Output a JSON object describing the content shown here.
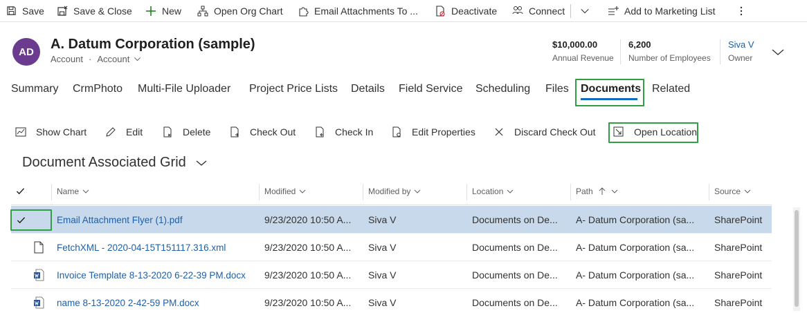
{
  "commandbar": {
    "save": "Save",
    "save_close": "Save & Close",
    "new": "New",
    "open_org_chart": "Open Org Chart",
    "email_attachments": "Email Attachments To ...",
    "deactivate": "Deactivate",
    "connect": "Connect",
    "add_to_marketing_list": "Add to Marketing List"
  },
  "record": {
    "avatar_initials": "AD",
    "title": "A. Datum Corporation (sample)",
    "entity": "Account",
    "form": "Account",
    "annual_revenue_value": "$10,000.00",
    "annual_revenue_label": "Annual Revenue",
    "employees_value": "6,200",
    "employees_label": "Number of Employees",
    "owner_value": "Siva V",
    "owner_label": "Owner"
  },
  "tabs": [
    {
      "label": "Summary"
    },
    {
      "label": "CrmPhoto"
    },
    {
      "label": "Multi-File Uploader"
    },
    {
      "label": "Project Price Lists"
    },
    {
      "label": "Details"
    },
    {
      "label": "Field Service"
    },
    {
      "label": "Scheduling"
    },
    {
      "label": "Files"
    },
    {
      "label": "Documents",
      "active": true
    },
    {
      "label": "Related"
    }
  ],
  "subgrid_commands": {
    "show_chart": "Show Chart",
    "edit": "Edit",
    "delete": "Delete",
    "check_out": "Check Out",
    "check_in": "Check In",
    "edit_properties": "Edit Properties",
    "discard_check_out": "Discard Check Out",
    "open_location": "Open Location"
  },
  "grid": {
    "title": "Document Associated Grid",
    "columns": {
      "name": "Name",
      "modified": "Modified",
      "modified_by": "Modified by",
      "location": "Location",
      "path": "Path",
      "source": "Source"
    },
    "rows": [
      {
        "icon": "pdf-file-icon",
        "name": "Email Attachment Flyer (1).pdf",
        "modified": "9/23/2020 10:50 A...",
        "modified_by": "Siva V",
        "location": "Documents on De...",
        "path": "A- Datum Corporation (sa...",
        "source": "SharePoint",
        "selected": true
      },
      {
        "icon": "blank-file-icon",
        "name": "FetchXML - 2020-04-15T151117.316.xml",
        "modified": "9/23/2020 10:50 A...",
        "modified_by": "Siva V",
        "location": "Documents on De...",
        "path": "A- Datum Corporation (sa...",
        "source": "SharePoint"
      },
      {
        "icon": "word-file-icon",
        "name": "Invoice Template 8-13-2020 6-22-39 PM.docx",
        "modified": "9/23/2020 10:50 A...",
        "modified_by": "Siva V",
        "location": "Documents on De...",
        "path": "A- Datum Corporation (sa...",
        "source": "SharePoint"
      },
      {
        "icon": "word-file-icon",
        "name": "name 8-13-2020 2-42-59 PM.docx",
        "modified": "9/23/2020 10:50 A...",
        "modified_by": "Siva V",
        "location": "Documents on De...",
        "path": "A- Datum Corporation (sa...",
        "source": "SharePoint"
      }
    ]
  },
  "colors": {
    "accent": "#0f6cbd",
    "highlight_box": "#2f9e44",
    "selected_row": "#c7d9ea",
    "avatar": "#6b3b8f",
    "link": "#1f5fa8"
  }
}
